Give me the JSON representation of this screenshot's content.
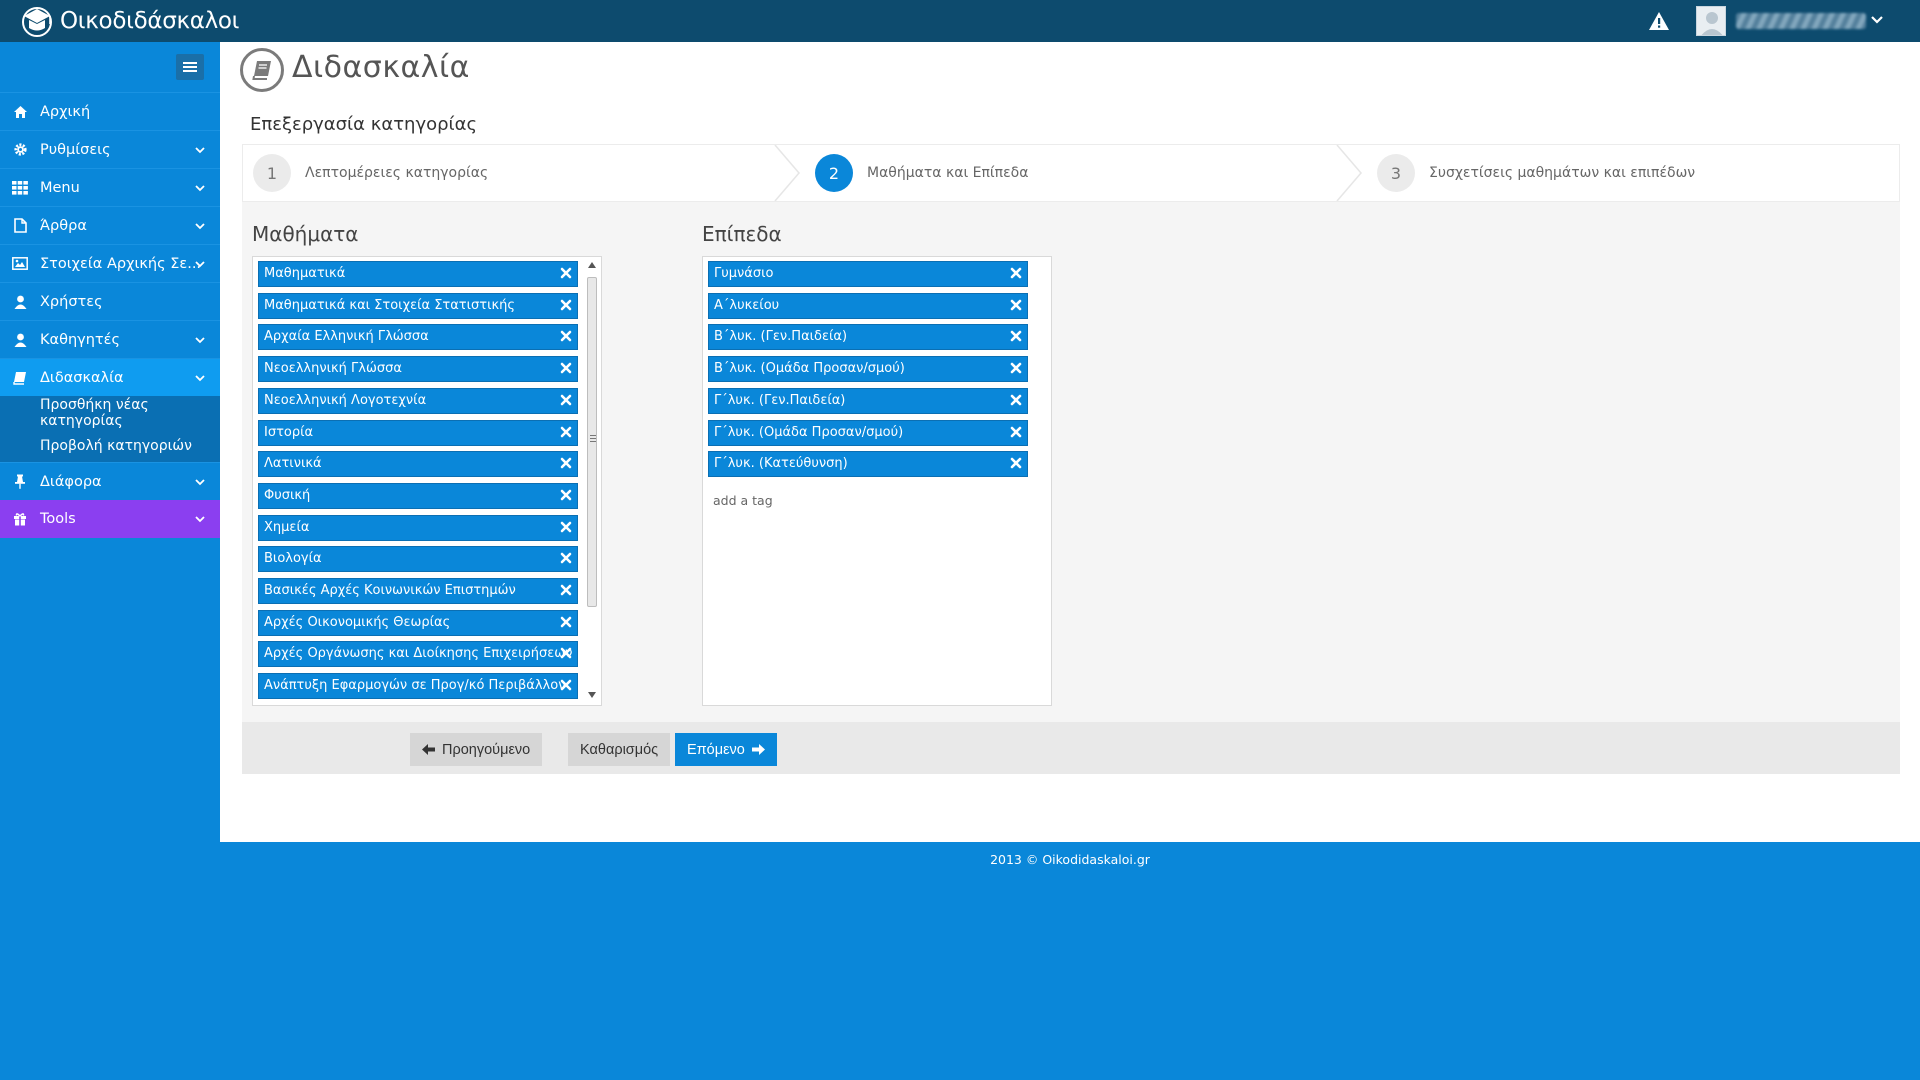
{
  "header": {
    "brand": "Οικοδιδάσκαλοι",
    "icons": {
      "logo": "graduation-cap-icon",
      "alert": "warning-triangle-icon",
      "user": "user-avatar-icon",
      "menu": "chevron-down-icon"
    }
  },
  "sidebar": {
    "items": [
      {
        "label": "Αρχική",
        "icon": "home-icon"
      },
      {
        "label": "Ρυθμίσεις",
        "icon": "gear-icon"
      },
      {
        "label": "Menu",
        "icon": "grid-icon"
      },
      {
        "label": "Άρθρα",
        "icon": "file-icon"
      },
      {
        "label": "Στοιχεία Αρχικής Σε...",
        "icon": "image-icon"
      },
      {
        "label": "Χρήστες",
        "icon": "user-icon"
      },
      {
        "label": "Καθηγητές",
        "icon": "teacher-icon"
      },
      {
        "label": "Διδασκαλία",
        "icon": "book-icon"
      },
      {
        "label": "Διάφορα",
        "icon": "pin-icon"
      },
      {
        "label": "Tools",
        "icon": "gift-icon"
      }
    ],
    "sub_items": [
      {
        "label": "Προσθήκη νέας κατηγορίας"
      },
      {
        "label": "Προβολή κατηγοριών"
      }
    ]
  },
  "page": {
    "title": "Διδασκαλία",
    "section_title": "Επεξεργασία κατηγορίας"
  },
  "steps": [
    {
      "number": "1",
      "label": "Λεπτομέρειες κατηγορίας"
    },
    {
      "number": "2",
      "label": "Μαθήματα και Επίπεδα"
    },
    {
      "number": "3",
      "label": "Συσχετίσεις μαθημάτων και επιπέδων"
    }
  ],
  "courses": {
    "title": "Μαθήματα",
    "tags": [
      "Μαθηματικά",
      "Μαθηματικά και Στοιχεία Στατιστικής",
      "Αρχαία Ελληνική Γλώσσα",
      "Νεοελληνική Γλώσσα",
      "Νεοελληνική Λογοτεχνία",
      "Ιστορία",
      "Λατινικά",
      "Φυσική",
      "Χημεία",
      "Βιολογία",
      "Βασικές Αρχές Κοινωνικών Επιστημών",
      "Αρχές Οικονομικής Θεωρίας",
      "Αρχές Οργάνωσης και Διοίκησης Επιχειρήσεων",
      "Ανάπτυξη Εφαρμογών σε Προγ/κό Περιβάλλον"
    ]
  },
  "levels": {
    "title": "Επίπεδα",
    "tags": [
      "Γυμνάσιο",
      "Α΄λυκείου",
      "Β΄λυκ. (Γεν.Παιδεία)",
      "Β΄λυκ. (Ομάδα Προσαν/σμού)",
      "Γ΄λυκ. (Γεν.Παιδεία)",
      "Γ΄λυκ. (Ομάδα Προσαν/σμού)",
      "Γ΄λυκ. (Κατεύθυνση)"
    ],
    "add_placeholder": "add a tag"
  },
  "buttons": {
    "previous": "Προηγούμενο",
    "clear": "Καθαρισμός",
    "next": "Επόμενο"
  },
  "footer": {
    "text": "2013 © Oikodidaskaloi.gr"
  }
}
